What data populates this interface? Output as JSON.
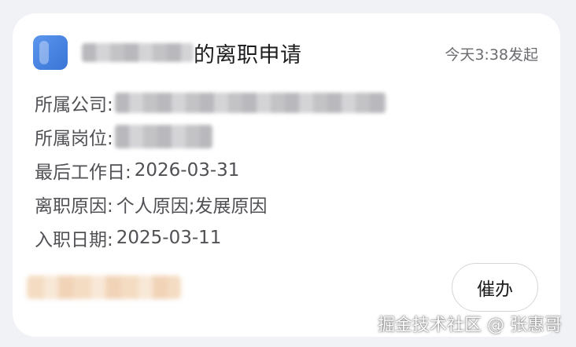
{
  "card": {
    "title_suffix": "的离职申请",
    "time": "今天3:38发起",
    "fields": [
      {
        "label": "所属公司:",
        "value": ""
      },
      {
        "label": "所属岗位:",
        "value": ""
      },
      {
        "label": "最后工作日:",
        "value": "2026-03-31"
      },
      {
        "label": "离职原因:",
        "value": "个人原因;发展原因"
      },
      {
        "label": "入职日期:",
        "value": "2025-03-11"
      }
    ],
    "urge_label": "催办"
  },
  "watermark": "掘金技术社区 @ 张惠哥",
  "colors": {
    "background": "#f1f2f5",
    "card": "#ffffff",
    "app_icon": "#4a86e8"
  }
}
